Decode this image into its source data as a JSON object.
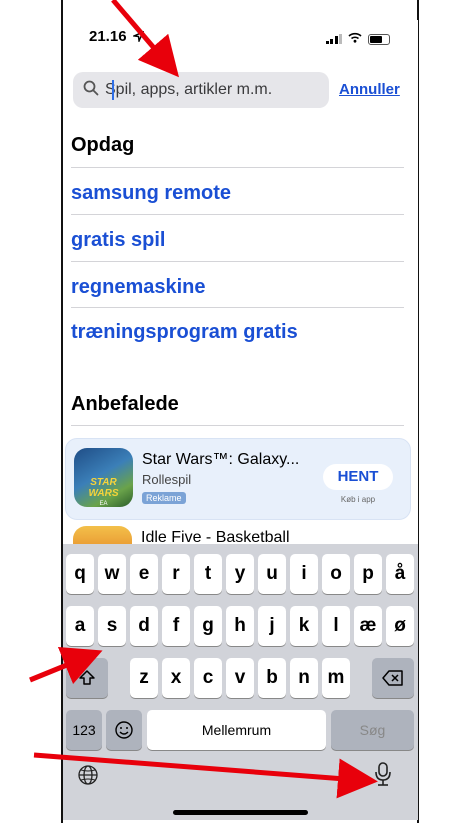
{
  "status": {
    "time": "21.16"
  },
  "search": {
    "placeholder": "Spil, apps, artikler m.m.",
    "cancel_label": "Annuller"
  },
  "discover": {
    "title": "Opdag",
    "items": [
      "samsung remote",
      "gratis spil",
      "regnemaskine",
      "træningsprogram gratis"
    ]
  },
  "recommended": {
    "title": "Anbefalede",
    "apps": [
      {
        "name": "Star Wars™: Galaxy...",
        "category": "Rollespil",
        "ad_badge": "Reklame",
        "action": "HENT",
        "note": "Køb i app",
        "icon_text": "STAR WARS",
        "icon_brand": "EA"
      },
      {
        "name": "Idle Five - Basketball"
      }
    ]
  },
  "keyboard": {
    "row1": [
      "q",
      "w",
      "e",
      "r",
      "t",
      "y",
      "u",
      "i",
      "o",
      "p",
      "å"
    ],
    "row2": [
      "a",
      "s",
      "d",
      "f",
      "g",
      "h",
      "j",
      "k",
      "l",
      "æ",
      "ø"
    ],
    "row3": [
      "z",
      "x",
      "c",
      "v",
      "b",
      "n",
      "m"
    ],
    "numbers_label": "123",
    "space_label": "Mellemrum",
    "search_label": "Søg"
  },
  "colors": {
    "accent": "#1a4fd4",
    "annotation": "#e8000b"
  }
}
